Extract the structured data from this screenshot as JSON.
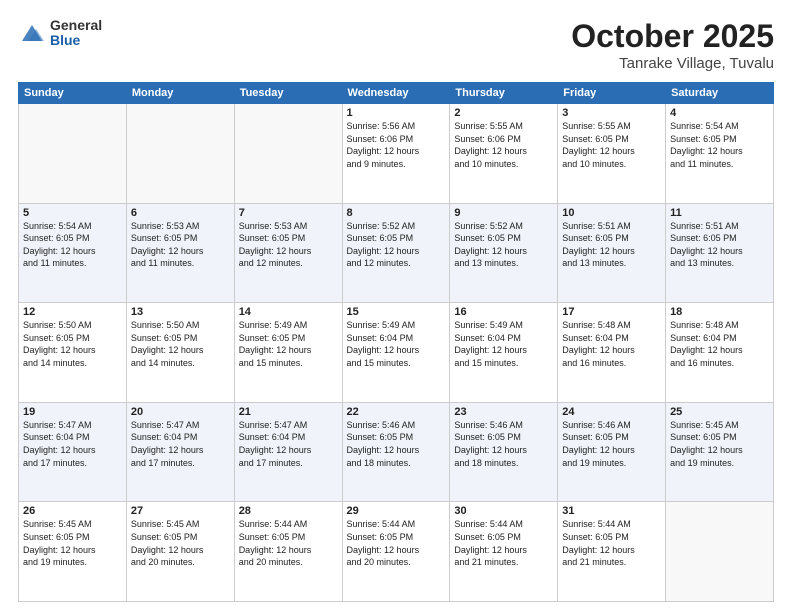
{
  "logo": {
    "general": "General",
    "blue": "Blue"
  },
  "header": {
    "month": "October 2025",
    "location": "Tanrake Village, Tuvalu"
  },
  "weekdays": [
    "Sunday",
    "Monday",
    "Tuesday",
    "Wednesday",
    "Thursday",
    "Friday",
    "Saturday"
  ],
  "weeks": [
    [
      {
        "day": "",
        "info": ""
      },
      {
        "day": "",
        "info": ""
      },
      {
        "day": "",
        "info": ""
      },
      {
        "day": "1",
        "info": "Sunrise: 5:56 AM\nSunset: 6:06 PM\nDaylight: 12 hours\nand 9 minutes."
      },
      {
        "day": "2",
        "info": "Sunrise: 5:55 AM\nSunset: 6:06 PM\nDaylight: 12 hours\nand 10 minutes."
      },
      {
        "day": "3",
        "info": "Sunrise: 5:55 AM\nSunset: 6:05 PM\nDaylight: 12 hours\nand 10 minutes."
      },
      {
        "day": "4",
        "info": "Sunrise: 5:54 AM\nSunset: 6:05 PM\nDaylight: 12 hours\nand 11 minutes."
      }
    ],
    [
      {
        "day": "5",
        "info": "Sunrise: 5:54 AM\nSunset: 6:05 PM\nDaylight: 12 hours\nand 11 minutes."
      },
      {
        "day": "6",
        "info": "Sunrise: 5:53 AM\nSunset: 6:05 PM\nDaylight: 12 hours\nand 11 minutes."
      },
      {
        "day": "7",
        "info": "Sunrise: 5:53 AM\nSunset: 6:05 PM\nDaylight: 12 hours\nand 12 minutes."
      },
      {
        "day": "8",
        "info": "Sunrise: 5:52 AM\nSunset: 6:05 PM\nDaylight: 12 hours\nand 12 minutes."
      },
      {
        "day": "9",
        "info": "Sunrise: 5:52 AM\nSunset: 6:05 PM\nDaylight: 12 hours\nand 13 minutes."
      },
      {
        "day": "10",
        "info": "Sunrise: 5:51 AM\nSunset: 6:05 PM\nDaylight: 12 hours\nand 13 minutes."
      },
      {
        "day": "11",
        "info": "Sunrise: 5:51 AM\nSunset: 6:05 PM\nDaylight: 12 hours\nand 13 minutes."
      }
    ],
    [
      {
        "day": "12",
        "info": "Sunrise: 5:50 AM\nSunset: 6:05 PM\nDaylight: 12 hours\nand 14 minutes."
      },
      {
        "day": "13",
        "info": "Sunrise: 5:50 AM\nSunset: 6:05 PM\nDaylight: 12 hours\nand 14 minutes."
      },
      {
        "day": "14",
        "info": "Sunrise: 5:49 AM\nSunset: 6:05 PM\nDaylight: 12 hours\nand 15 minutes."
      },
      {
        "day": "15",
        "info": "Sunrise: 5:49 AM\nSunset: 6:04 PM\nDaylight: 12 hours\nand 15 minutes."
      },
      {
        "day": "16",
        "info": "Sunrise: 5:49 AM\nSunset: 6:04 PM\nDaylight: 12 hours\nand 15 minutes."
      },
      {
        "day": "17",
        "info": "Sunrise: 5:48 AM\nSunset: 6:04 PM\nDaylight: 12 hours\nand 16 minutes."
      },
      {
        "day": "18",
        "info": "Sunrise: 5:48 AM\nSunset: 6:04 PM\nDaylight: 12 hours\nand 16 minutes."
      }
    ],
    [
      {
        "day": "19",
        "info": "Sunrise: 5:47 AM\nSunset: 6:04 PM\nDaylight: 12 hours\nand 17 minutes."
      },
      {
        "day": "20",
        "info": "Sunrise: 5:47 AM\nSunset: 6:04 PM\nDaylight: 12 hours\nand 17 minutes."
      },
      {
        "day": "21",
        "info": "Sunrise: 5:47 AM\nSunset: 6:04 PM\nDaylight: 12 hours\nand 17 minutes."
      },
      {
        "day": "22",
        "info": "Sunrise: 5:46 AM\nSunset: 6:05 PM\nDaylight: 12 hours\nand 18 minutes."
      },
      {
        "day": "23",
        "info": "Sunrise: 5:46 AM\nSunset: 6:05 PM\nDaylight: 12 hours\nand 18 minutes."
      },
      {
        "day": "24",
        "info": "Sunrise: 5:46 AM\nSunset: 6:05 PM\nDaylight: 12 hours\nand 19 minutes."
      },
      {
        "day": "25",
        "info": "Sunrise: 5:45 AM\nSunset: 6:05 PM\nDaylight: 12 hours\nand 19 minutes."
      }
    ],
    [
      {
        "day": "26",
        "info": "Sunrise: 5:45 AM\nSunset: 6:05 PM\nDaylight: 12 hours\nand 19 minutes."
      },
      {
        "day": "27",
        "info": "Sunrise: 5:45 AM\nSunset: 6:05 PM\nDaylight: 12 hours\nand 20 minutes."
      },
      {
        "day": "28",
        "info": "Sunrise: 5:44 AM\nSunset: 6:05 PM\nDaylight: 12 hours\nand 20 minutes."
      },
      {
        "day": "29",
        "info": "Sunrise: 5:44 AM\nSunset: 6:05 PM\nDaylight: 12 hours\nand 20 minutes."
      },
      {
        "day": "30",
        "info": "Sunrise: 5:44 AM\nSunset: 6:05 PM\nDaylight: 12 hours\nand 21 minutes."
      },
      {
        "day": "31",
        "info": "Sunrise: 5:44 AM\nSunset: 6:05 PM\nDaylight: 12 hours\nand 21 minutes."
      },
      {
        "day": "",
        "info": ""
      }
    ]
  ]
}
